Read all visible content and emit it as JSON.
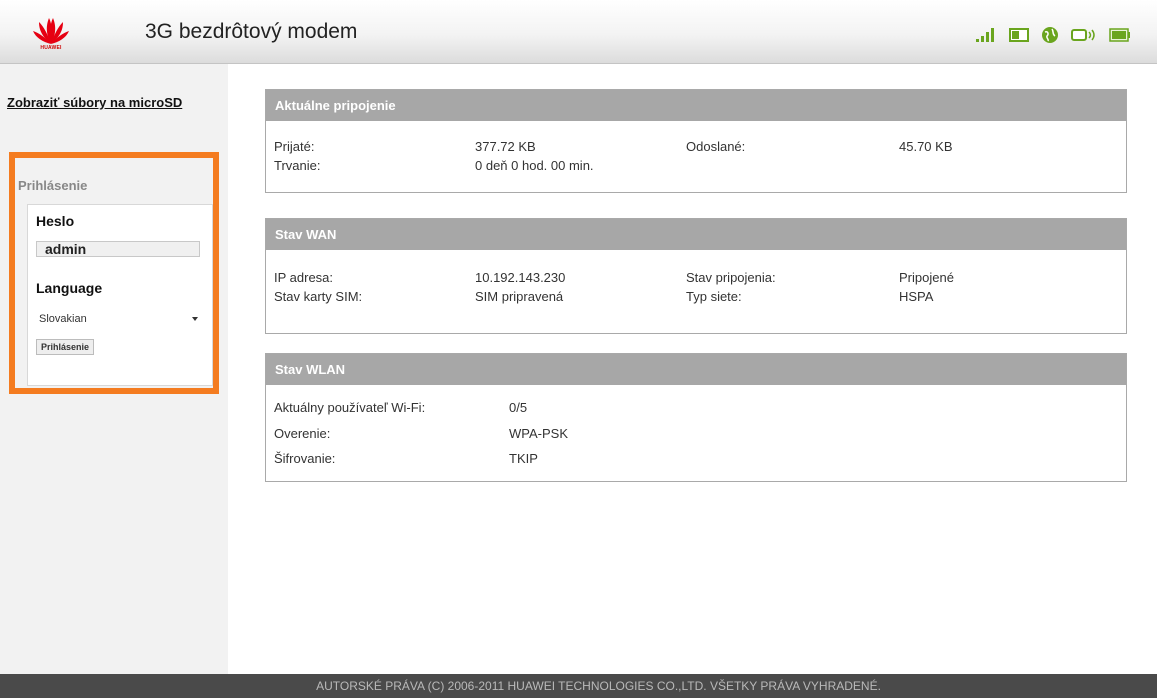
{
  "header": {
    "logo_text": "HUAWEI",
    "title": "3G bezdrôtový modem",
    "status_icons": [
      "signal-strength-icon",
      "sim-card-icon",
      "internet-globe-icon",
      "wifi-device-icon",
      "battery-icon"
    ]
  },
  "sidebar": {
    "microsd_link": "Zobraziť súbory na microSD",
    "login": {
      "title": "Prihlásenie",
      "password_label": "Heslo",
      "password_value": "admin",
      "language_label": "Language",
      "language_selected": "Slovakian",
      "login_button": "Prihlásenie"
    }
  },
  "connection": {
    "title": "Aktuálne pripojenie",
    "received_label": "Prijaté:",
    "received_value": "377.72 KB",
    "sent_label": "Odoslané:",
    "sent_value": "45.70 KB",
    "duration_label": "Trvanie:",
    "duration_value": "0 deň 0 hod. 00 min."
  },
  "wan": {
    "title": "Stav WAN",
    "ip_label": "IP adresa:",
    "ip_value": "10.192.143.230",
    "conn_state_label": "Stav pripojenia:",
    "conn_state_value": "Pripojené",
    "sim_label": "Stav karty SIM:",
    "sim_value": "SIM pripravená",
    "network_type_label": "Typ siete:",
    "network_type_value": "HSPA"
  },
  "wlan": {
    "title": "Stav WLAN",
    "users_label": "Aktuálny používateľ Wi-Fi:",
    "users_value": "0/5",
    "auth_label": "Overenie:",
    "auth_value": "WPA-PSK",
    "encryption_label": "Šifrovanie:",
    "encryption_value": "TKIP"
  },
  "footer": {
    "copyright": "AUTORSKÉ PRÁVA (C) 2006-2011 HUAWEI TECHNOLOGIES CO.,LTD. VŠETKY PRÁVA VYHRADENÉ."
  },
  "colors": {
    "accent_orange": "#f47c20",
    "panel_header": "#a7a7a7",
    "brand_red": "#e60012",
    "status_green": "#6aa51e",
    "footer_bg": "#4a4a4a"
  }
}
